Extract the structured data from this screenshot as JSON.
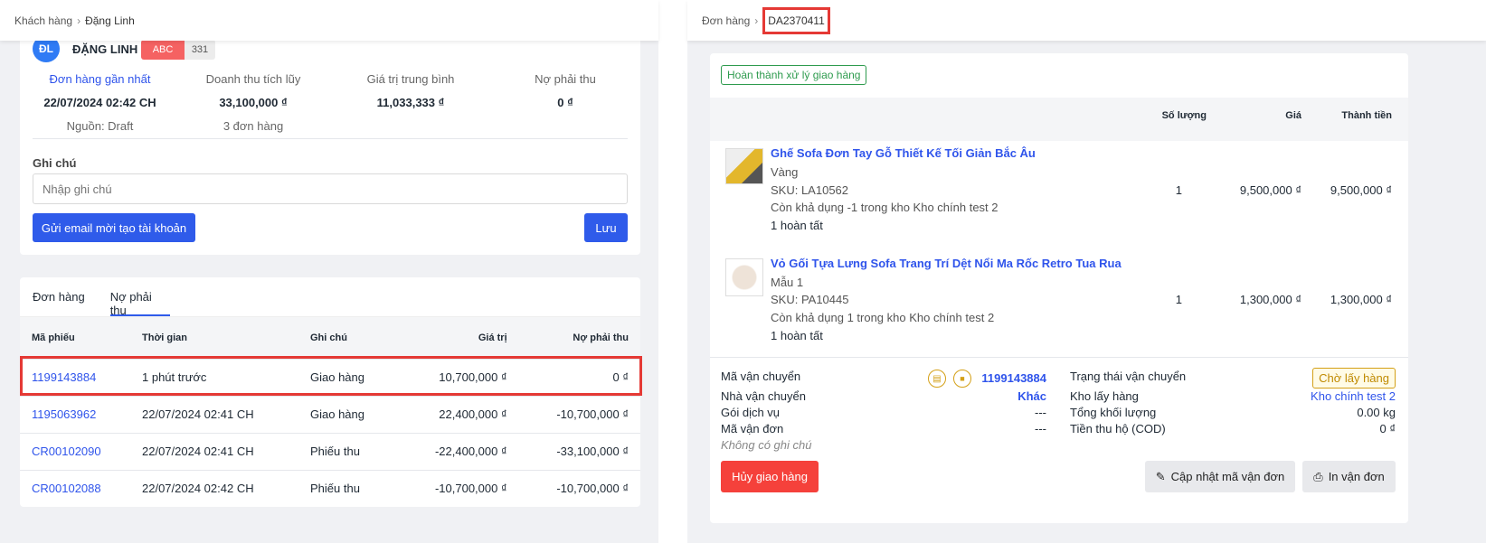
{
  "left": {
    "breadcrumb": [
      "Khách hàng",
      "Đặng Linh"
    ],
    "customer": {
      "initials": "ĐL",
      "name": "ĐẶNG LINH",
      "tag": "ABC",
      "tag_count": "331"
    },
    "stats": [
      {
        "label": "Đơn hàng gần nhất",
        "value": "22/07/2024 02:42 CH",
        "sub": "Nguồn: Draft"
      },
      {
        "label": "Doanh thu tích lũy",
        "value": "33,100,000 ₫",
        "sub": "3 đơn hàng"
      },
      {
        "label": "Giá trị trung bình",
        "value": "11,033,333 ₫",
        "sub": ""
      },
      {
        "label": "Nợ phải thu",
        "value": "0 ₫",
        "sub": ""
      }
    ],
    "note_label": "Ghi chú",
    "note_placeholder": "Nhập ghi chú",
    "invite_button": "Gửi email mời tạo tài khoản",
    "save_button": "Lưu",
    "tabs": [
      "Đơn hàng",
      "Nợ phải thu"
    ],
    "active_tab": "Nợ phải thu",
    "table": {
      "headers": [
        "Mã phiếu",
        "Thời gian",
        "Ghi chú",
        "Giá trị",
        "Nợ phải thu"
      ],
      "rows": [
        [
          "1199143884",
          "1 phút trước",
          "Giao hàng",
          "10,700,000 ₫",
          "0 ₫"
        ],
        [
          "1195063962",
          "22/07/2024 02:41 CH",
          "Giao hàng",
          "22,400,000 ₫",
          "-10,700,000 ₫"
        ],
        [
          "CR00102090",
          "22/07/2024 02:41 CH",
          "Phiếu thu",
          "-22,400,000 ₫",
          "-33,100,000 ₫"
        ],
        [
          "CR00102088",
          "22/07/2024 02:42 CH",
          "Phiếu thu",
          "-10,700,000 ₫",
          "-10,700,000 ₫"
        ]
      ]
    }
  },
  "right": {
    "breadcrumb": [
      "Đơn hàng",
      "DA2370411"
    ],
    "status_badge": "Hoàn thành xử lý giao hàng",
    "headers": [
      "Số lượng",
      "Giá",
      "Thành tiền"
    ],
    "items": [
      {
        "name": "Ghế Sofa Đơn Tay Gỗ Thiết Kế Tối Giản Bắc Âu",
        "variant": "Vàng",
        "sku": "SKU: LA10562",
        "stock": "Còn khả dụng -1 trong kho Kho chính test 2",
        "done": "1 hoàn tất",
        "qty": "1",
        "price": "9,500,000 ₫",
        "total": "9,500,000 ₫"
      },
      {
        "name": "Vỏ Gối Tựa Lưng Sofa Trang Trí Dệt Nổi Ma Rốc Retro Tua Rua",
        "variant": "Mẫu 1",
        "sku": "SKU: PA10445",
        "stock": "Còn khả dụng 1 trong kho Kho chính test 2",
        "done": "1 hoàn tất",
        "qty": "1",
        "price": "1,300,000 ₫",
        "total": "1,300,000 ₫"
      }
    ],
    "shipping": {
      "tracking_label": "Mã vận chuyển",
      "tracking": "1199143884",
      "carrier_label": "Nhà vận chuyển",
      "carrier": "Khác",
      "service_label": "Gói dịch vụ",
      "service": "---",
      "waybill_label": "Mã vận đơn",
      "waybill": "---",
      "note": "Không có ghi chú",
      "status_label": "Trạng thái vận chuyển",
      "status": "Chờ lấy hàng",
      "warehouse_label": "Kho lấy hàng",
      "warehouse": "Kho chính test 2",
      "weight_label": "Tổng khối lượng",
      "weight": "0.00 kg",
      "cod_label": "Tiền thu hộ (COD)",
      "cod": "0 ₫"
    },
    "cancel_button": "Hủy giao hàng",
    "update_button": "Cập nhật mã vận đơn",
    "print_button": "In vận đơn"
  },
  "colors": {
    "accent": "#2f54eb",
    "danger": "#f5413b",
    "highlight": "#e53935",
    "warning": "#d4a017",
    "success": "#2e9b4e"
  }
}
